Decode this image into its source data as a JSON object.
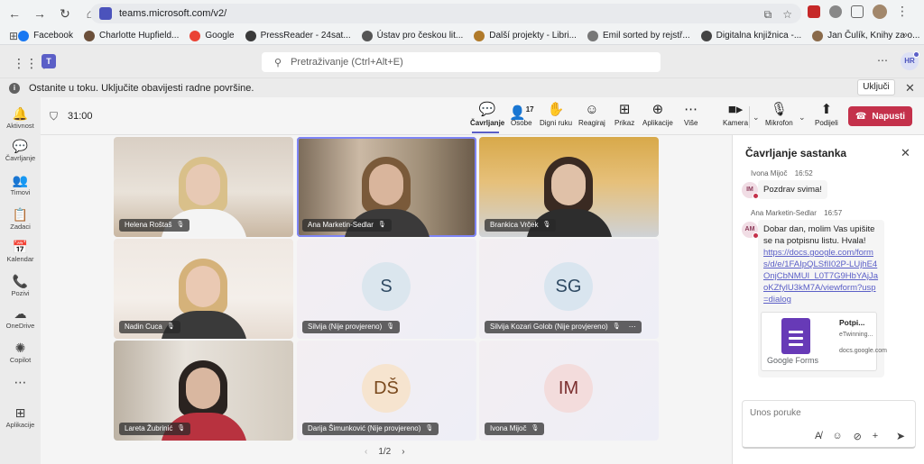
{
  "browser": {
    "url": "teams.microsoft.com/v2/",
    "bookmarks": [
      {
        "label": "Facebook",
        "color": "#1877f2"
      },
      {
        "label": "Charlotte Hupfield...",
        "color": "#6b4f3a"
      },
      {
        "label": "Google",
        "color": "#ea4335"
      },
      {
        "label": "PressReader - 24sat...",
        "color": "#3a3a3a"
      },
      {
        "label": "Ústav pro českou lit...",
        "color": "#555555"
      },
      {
        "label": "Další projekty - Libri...",
        "color": "#b07a2a"
      },
      {
        "label": "Emil sorted by rejstř...",
        "color": "#777777"
      },
      {
        "label": "Digitalna knjižnica -...",
        "color": "#444444"
      },
      {
        "label": "Jan Čulík, Knihy za o...",
        "color": "#8a6a4a"
      }
    ]
  },
  "header": {
    "search_placeholder": "Pretraživanje (Ctrl+Alt+E)",
    "avatar_initials": "HR"
  },
  "notification": {
    "text": "Ostanite u toku. Uključite obavijesti radne površine.",
    "button": "Uključi"
  },
  "rail": [
    {
      "label": "Aktivnost",
      "icon": "bell-icon",
      "glyph": "🔔"
    },
    {
      "label": "Čavrljanje",
      "icon": "chat-icon",
      "glyph": "💬"
    },
    {
      "label": "Timovi",
      "icon": "teams-icon",
      "glyph": "👥"
    },
    {
      "label": "Zadaci",
      "icon": "tasks-icon",
      "glyph": "📋"
    },
    {
      "label": "Kalendar",
      "icon": "calendar-icon",
      "glyph": "📅"
    },
    {
      "label": "Pozivi",
      "icon": "phone-icon",
      "glyph": "📞"
    },
    {
      "label": "OneDrive",
      "icon": "cloud-icon",
      "glyph": "☁"
    },
    {
      "label": "Copilot",
      "icon": "copilot-icon",
      "glyph": "✺"
    },
    {
      "label": "",
      "icon": "more-icon",
      "glyph": "⋯"
    },
    {
      "label": "Aplikacije",
      "icon": "apps-icon",
      "glyph": "⊞"
    }
  ],
  "toolbar": {
    "timer": "31:00",
    "people_count": "17",
    "buttons": {
      "chat": "Čavrljanje",
      "people": "Osobe",
      "raise_hand": "Digni ruku",
      "react": "Reagiraj",
      "view": "Prikaz",
      "apps": "Aplikacije",
      "more": "Više",
      "camera": "Kamera",
      "mic": "Mikrofon",
      "share": "Podijeli"
    },
    "leave": "Napusti"
  },
  "participants": [
    {
      "name": "Helena Roštaš",
      "type": "video"
    },
    {
      "name": "Ana Marketin-Sedlar",
      "type": "video",
      "speaking": true
    },
    {
      "name": "Brankica Vrček",
      "type": "video"
    },
    {
      "name": "Nadin Cuca",
      "type": "video"
    },
    {
      "name": "Silvija (Nije provjereno)",
      "type": "avatar",
      "initials": "S",
      "bg": "#dbe6ee",
      "fg": "#2f4a63"
    },
    {
      "name": "Silvija Kozari Golob (Nije provjereno)",
      "type": "avatar",
      "initials": "SG",
      "bg": "#d9e5ef",
      "fg": "#2f4a63"
    },
    {
      "name": "Lareta Žubrinić",
      "type": "video"
    },
    {
      "name": "Darija Šimunković (Nije provjereno)",
      "type": "avatar",
      "initials": "DŠ",
      "bg": "#f6e4cf",
      "fg": "#7a4a1e"
    },
    {
      "name": "Ivona Mijoč",
      "type": "avatar",
      "initials": "IM",
      "bg": "#f3dcdc",
      "fg": "#7a2e2e"
    }
  ],
  "pager": "1/2",
  "chat": {
    "title": "Čavrljanje sastanka",
    "messages": [
      {
        "author": "Ivona Mijoč",
        "time": "16:52",
        "initials": "IM",
        "text": "Pozdrav svima!"
      },
      {
        "author": "Ana Marketin-Sedlar",
        "time": "16:57",
        "initials": "AM",
        "text": "Dobar dan, molim Vas upišite se na potpisnu listu. Hvala!",
        "link": "https://docs.google.com/forms/d/e/1FAIpQLSfII02P-LUjhE4OnjCbNMUI_L0T7G9HbYAjJaoKZfylU3kM7A/viewform?usp=dialog"
      }
    ],
    "card": {
      "title": "Potpi...",
      "subtitle": "eTwinning...",
      "domain": "docs.google.com",
      "brand": "Google Forms"
    },
    "composer_placeholder": "Unos poruke"
  }
}
